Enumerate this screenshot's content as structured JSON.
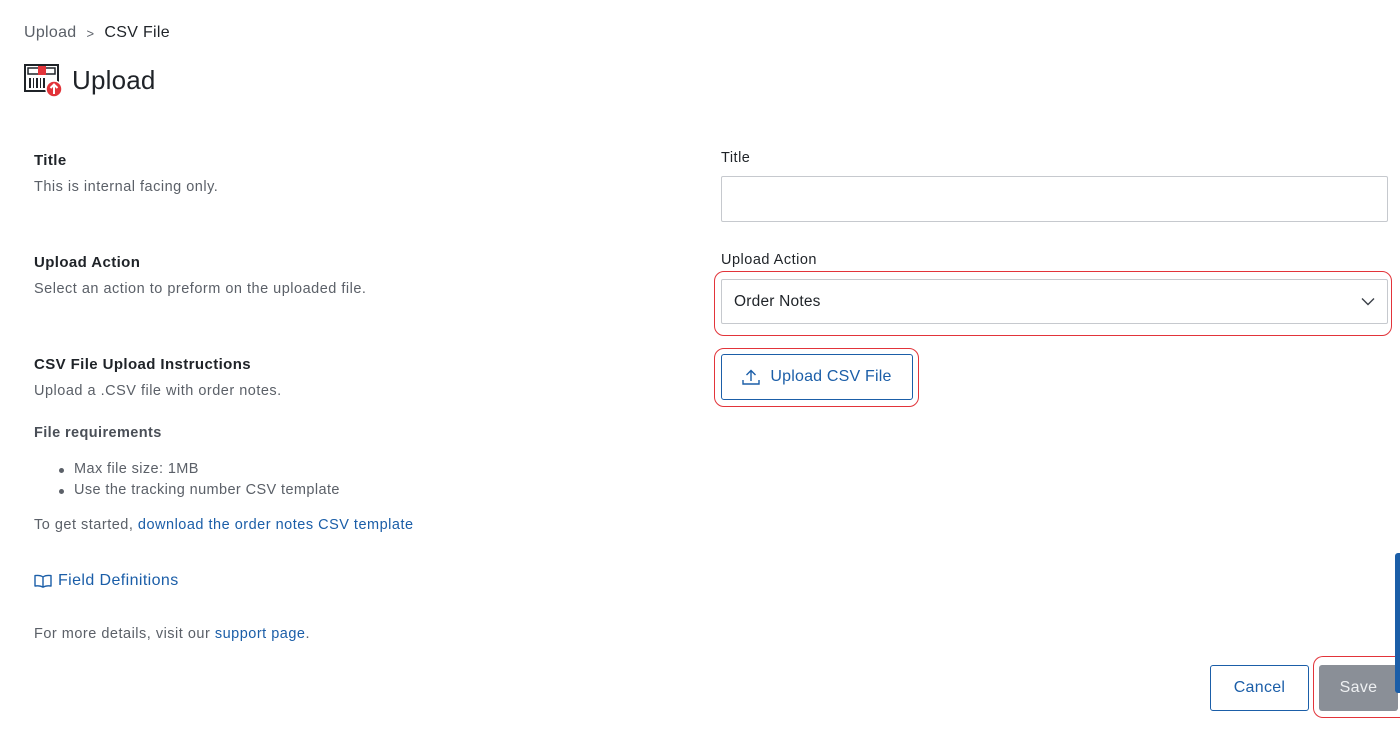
{
  "breadcrumb": {
    "parent": "Upload",
    "separator": ">",
    "current": "CSV File"
  },
  "page": {
    "title": "Upload",
    "icon": "upload-box-icon"
  },
  "sections": {
    "title": {
      "heading": "Title",
      "description": "This is internal facing only."
    },
    "upload_action": {
      "heading": "Upload Action",
      "description": "Select an action to preform on the uploaded file."
    },
    "instructions": {
      "heading": "CSV File Upload Instructions",
      "description": "Upload a .CSV file with order notes.",
      "requirements_title": "File requirements",
      "requirements": [
        "Max file size: 1MB",
        "Use the tracking number CSV template"
      ],
      "get_started_prefix": "To get started, ",
      "get_started_link": "download the order notes CSV template"
    },
    "field_definitions": {
      "label": "Field Definitions",
      "icon": "book-icon"
    },
    "more_details": {
      "prefix": "For more details, visit our ",
      "link": "support page",
      "suffix": "."
    }
  },
  "form": {
    "title_label": "Title",
    "title_value": "",
    "title_placeholder": "",
    "action_label": "Upload Action",
    "action_value": "Order Notes",
    "upload_button": "Upload CSV File"
  },
  "footer": {
    "cancel": "Cancel",
    "save": "Save"
  },
  "colors": {
    "link": "#1b5ea8",
    "highlight": "#e2343a",
    "save_disabled": "#8a8f97"
  }
}
